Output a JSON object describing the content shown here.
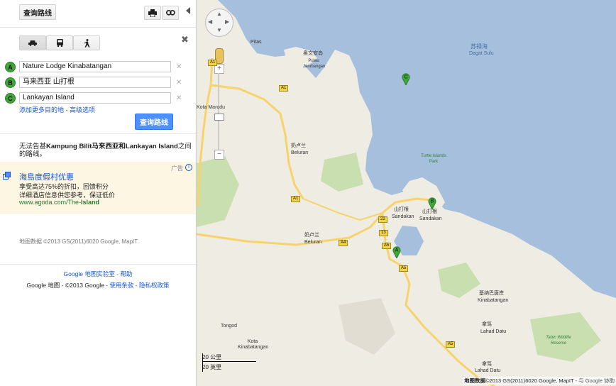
{
  "panel": {
    "tab_title": "查询路线",
    "travel_modes": [
      "car-icon",
      "bus-icon",
      "walk-icon"
    ],
    "waypoints": [
      {
        "letter": "A",
        "value": "Nature Lodge Kinabatangan"
      },
      {
        "letter": "B",
        "value": "马来西亚 山打根"
      },
      {
        "letter": "C",
        "value": "Lankayan Island"
      }
    ],
    "add_destination": "添加更多目的地",
    "separator": " - ",
    "advanced_options": "高级选项",
    "submit": "查询路线",
    "message_prefix": "无法告甚",
    "message_bold": "Kampung Bilit马来西亚和Lankayan Island",
    "message_suffix": "之间的路线。",
    "ad": {
      "label": "广告",
      "title": "海島度假村优惠",
      "line1": "享受高达75%的折扣，回馈积分",
      "line2": "详细酒店信息供您参考，保证低价",
      "url_prefix": "www.agoda.com/The-",
      "url_bold": "Island"
    },
    "map_data": "地图数据 ©2013 GS(2011)6020 Google, MapIT",
    "footer": {
      "labs_google": "Google",
      "labs": "地图实验室",
      "help": "帮助",
      "brand": "Google 地图",
      "copyright": " - ©2013 Google - ",
      "terms": "使用条款",
      "privacy": "隐私权政策"
    }
  },
  "map": {
    "labels": {
      "pitas": "Pitas",
      "pulau_jambongan_cn": "奥文安岛",
      "pulau_jambongan": "Pulau Jambangan",
      "sulu_sea_cn": "苏禄海",
      "sulu_sea": "Dagat Sulu",
      "kota_marudu": "Kota Marudu",
      "beluran_cn": "奶卢兰",
      "beluran": "Beluran",
      "turtle_islands": "Turtle Islands Park",
      "sandakan_cn": "山打根",
      "sandakan": "Sandakan",
      "sandakan2_cn": "山打根",
      "sandakan2": "Sandakan",
      "beluran2_cn": "奶卢兰",
      "beluran2": "Beluran",
      "kinabatangan_cn": "基纳巴唐岸",
      "kinabatangan": "Kinabatangan",
      "tongod": "Tongod",
      "kota_kinabatangan": "Kota Kinabatangan",
      "lahad_datu_cn": "拿笃",
      "lahad_datu": "Lahad Datu",
      "lahad_datu2_cn": "拿笃",
      "lahad_datu2": "Lahad Datu",
      "tabin": "Tabin Wildlife Reserve"
    },
    "roads": [
      "A1",
      "A1",
      "A1",
      "A4",
      "22",
      "13",
      "A5",
      "A5",
      "A5"
    ],
    "markers": [
      "A",
      "B",
      "C"
    ],
    "scale_km": "20 公里",
    "scale_mi": "20 英里",
    "attribution": "地图数据 ©2013 GS(2011)6020 Google, MapIT",
    "attribution_bold": "地图数据",
    "attribution_rest": "©2013 GS(2011)6020 Google, MapIT - ",
    "google_label": "Google",
    "google_more": "与 Google 协助",
    "colors": {
      "sea": "#a5bfdd",
      "land": "#efece3",
      "green": "#c9dfaf",
      "road": "#f7d36b",
      "marker": "#3fa63a"
    }
  }
}
